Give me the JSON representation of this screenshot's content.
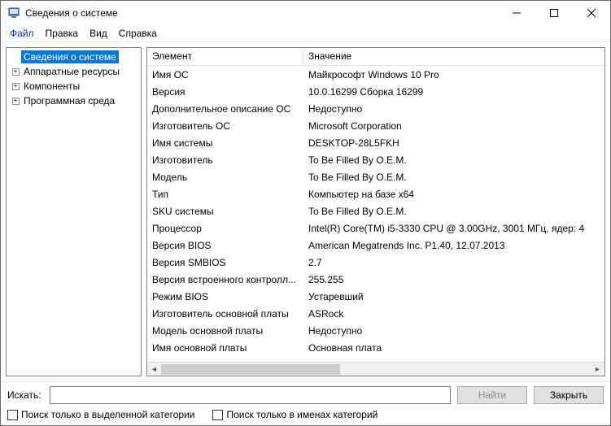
{
  "window": {
    "title": "Сведения о системе"
  },
  "menu": {
    "file": "Файл",
    "edit": "Правка",
    "view": "Вид",
    "help": "Справка"
  },
  "tree": {
    "root": "Сведения о системе",
    "items": [
      {
        "label": "Аппаратные ресурсы"
      },
      {
        "label": "Компоненты"
      },
      {
        "label": "Программная среда"
      }
    ]
  },
  "columns": {
    "name": "Элемент",
    "value": "Значение"
  },
  "rows": [
    {
      "name": "Имя ОС",
      "value": "Майкрософт Windows 10 Pro"
    },
    {
      "name": "Версия",
      "value": "10.0.16299 Сборка 16299"
    },
    {
      "name": "Дополнительное описание ОС",
      "value": "Недоступно"
    },
    {
      "name": "Изготовитель ОС",
      "value": "Microsoft Corporation"
    },
    {
      "name": "Имя системы",
      "value": "DESKTOP-28L5FKH"
    },
    {
      "name": "Изготовитель",
      "value": "To Be Filled By O.E.M."
    },
    {
      "name": "Модель",
      "value": "To Be Filled By O.E.M."
    },
    {
      "name": "Тип",
      "value": "Компьютер на базе x64"
    },
    {
      "name": "SKU системы",
      "value": "To Be Filled By O.E.M."
    },
    {
      "name": "Процессор",
      "value": "Intel(R) Core(TM) i5-3330 CPU @ 3.00GHz, 3001 МГц, ядер: 4"
    },
    {
      "name": "Версия BIOS",
      "value": "American Megatrends Inc. P1.40, 12.07.2013",
      "underline_name": true,
      "underline_value": true
    },
    {
      "name": "Версия SMBIOS",
      "value": "2.7"
    },
    {
      "name": "Версия встроенного контролл...",
      "value": "255.255"
    },
    {
      "name": "Режим BIOS",
      "value": "Устаревший"
    },
    {
      "name": "Изготовитель основной платы",
      "value": "ASRock",
      "underline_name": true,
      "underline_value": true
    },
    {
      "name": "Модель основной платы",
      "value": "Недоступно",
      "underline_name": true,
      "underline_value": true
    },
    {
      "name": "Имя основной платы",
      "value": "Основная плата"
    }
  ],
  "search": {
    "label": "Искать:",
    "placeholder": "",
    "find_btn": "Найти",
    "close_btn": "Закрыть",
    "chk_category": "Поиск только в выделенной категории",
    "chk_names": "Поиск только в именах категорий"
  }
}
